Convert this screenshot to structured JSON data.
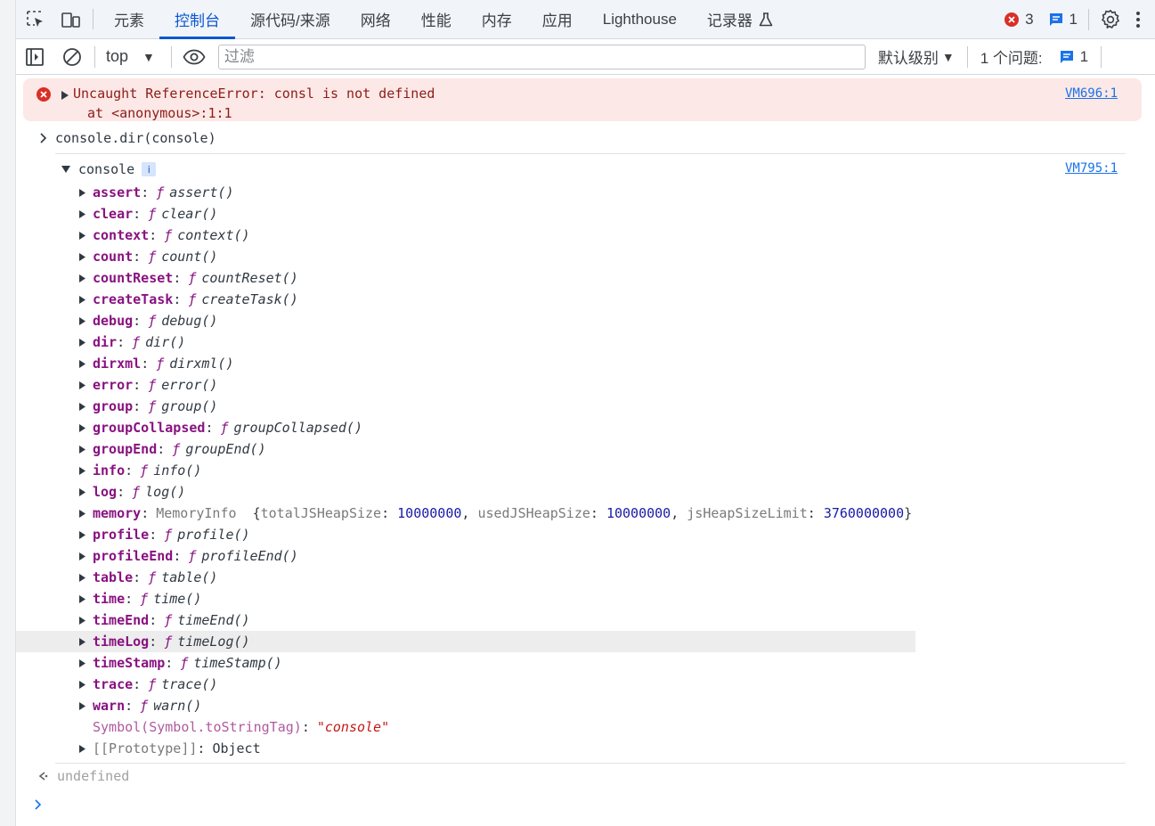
{
  "tabs": [
    {
      "label": "元素",
      "active": false
    },
    {
      "label": "控制台",
      "active": true
    },
    {
      "label": "源代码/来源",
      "active": false
    },
    {
      "label": "网络",
      "active": false
    },
    {
      "label": "性能",
      "active": false
    },
    {
      "label": "内存",
      "active": false
    },
    {
      "label": "应用",
      "active": false
    },
    {
      "label": "Lighthouse",
      "active": false
    },
    {
      "label": "记录器",
      "active": false,
      "icon": "flask-icon"
    }
  ],
  "status": {
    "error_count": "3",
    "message_count": "1"
  },
  "toolbar": {
    "context": "top",
    "filter_placeholder": "过滤",
    "level": "默认级别",
    "issues_label": "1 个问题:",
    "issues_count": "1"
  },
  "error": {
    "message": "Uncaught ReferenceError: consl is not defined",
    "stack": "at <anonymous>:1:1",
    "source": "VM696:1"
  },
  "input": {
    "command": "console.dir(console)"
  },
  "object": {
    "name": "console",
    "info_badge": "i",
    "source": "VM795:1",
    "properties": [
      {
        "key": "assert",
        "fn": "assert()"
      },
      {
        "key": "clear",
        "fn": "clear()"
      },
      {
        "key": "context",
        "fn": "context()"
      },
      {
        "key": "count",
        "fn": "count()"
      },
      {
        "key": "countReset",
        "fn": "countReset()"
      },
      {
        "key": "createTask",
        "fn": "createTask()"
      },
      {
        "key": "debug",
        "fn": "debug()"
      },
      {
        "key": "dir",
        "fn": "dir()"
      },
      {
        "key": "dirxml",
        "fn": "dirxml()"
      },
      {
        "key": "error",
        "fn": "error()"
      },
      {
        "key": "group",
        "fn": "group()"
      },
      {
        "key": "groupCollapsed",
        "fn": "groupCollapsed()"
      },
      {
        "key": "groupEnd",
        "fn": "groupEnd()"
      },
      {
        "key": "info",
        "fn": "info()"
      },
      {
        "key": "log",
        "fn": "log()"
      }
    ],
    "memory": {
      "key": "memory",
      "class": "MemoryInfo",
      "fields": [
        {
          "k": "totalJSHeapSize",
          "v": "10000000"
        },
        {
          "k": "usedJSHeapSize",
          "v": "10000000"
        },
        {
          "k": "jsHeapSizeLimit",
          "v": "3760000000"
        }
      ]
    },
    "properties2": [
      {
        "key": "profile",
        "fn": "profile()"
      },
      {
        "key": "profileEnd",
        "fn": "profileEnd()"
      },
      {
        "key": "table",
        "fn": "table()"
      },
      {
        "key": "time",
        "fn": "time()"
      },
      {
        "key": "timeEnd",
        "fn": "timeEnd()"
      },
      {
        "key": "timeLog",
        "fn": "timeLog()",
        "highlighted": true
      },
      {
        "key": "timeStamp",
        "fn": "timeStamp()"
      },
      {
        "key": "trace",
        "fn": "trace()"
      },
      {
        "key": "warn",
        "fn": "warn()"
      }
    ],
    "symbol": {
      "key": "Symbol(Symbol.toStringTag)",
      "value": "\"console\""
    },
    "prototype": {
      "key": "[[Prototype]]",
      "value": "Object"
    }
  },
  "result": {
    "value": "undefined"
  },
  "colors": {
    "accent": "#0b57d0",
    "error_bg": "#fce8e6",
    "error_text": "#8c1d18",
    "key": "#881280",
    "number": "#1a1aa6",
    "string": "#c41a16"
  }
}
